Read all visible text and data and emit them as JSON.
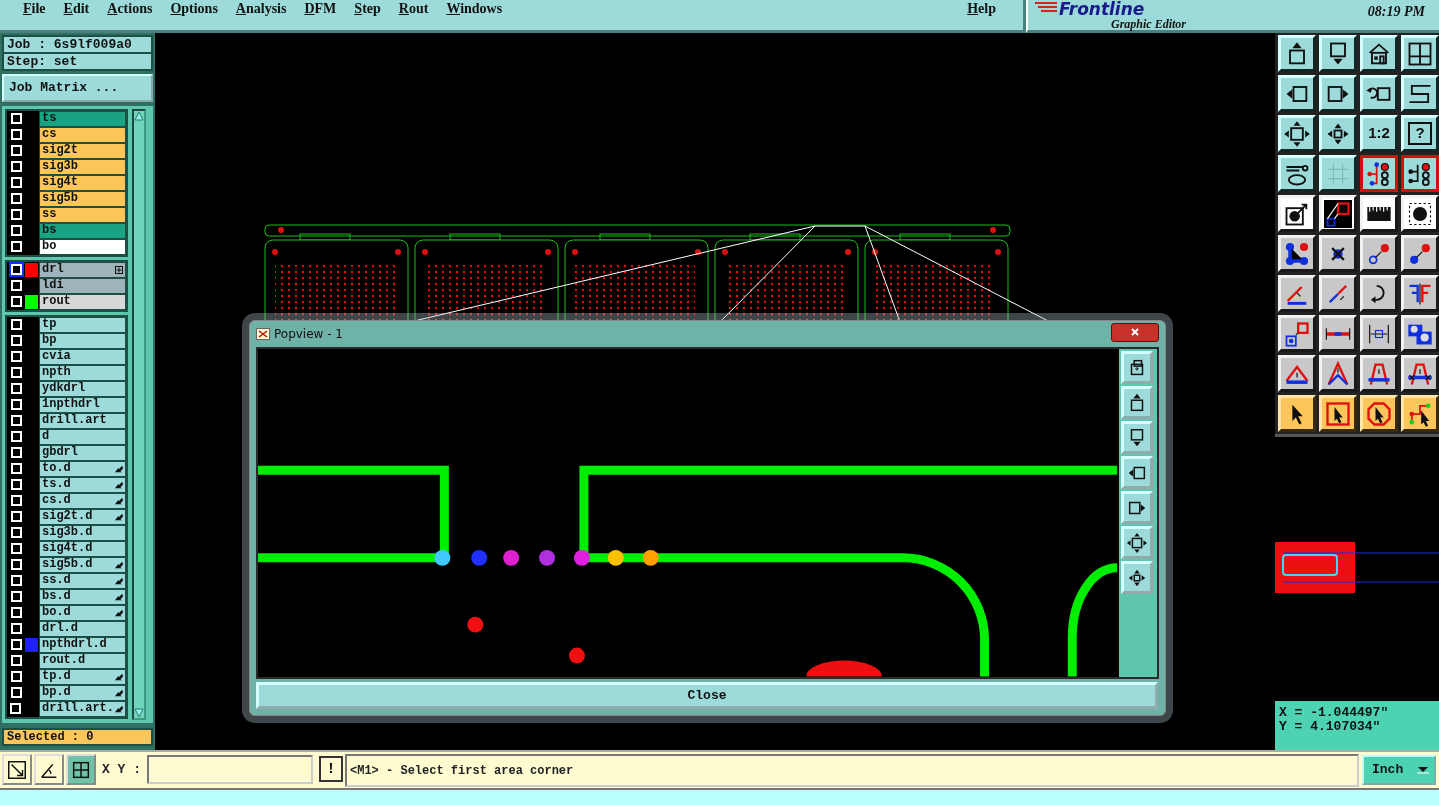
{
  "menu": [
    {
      "label": "File"
    },
    {
      "label": "Edit"
    },
    {
      "label": "Actions"
    },
    {
      "label": "Options"
    },
    {
      "label": "Analysis"
    },
    {
      "label": "DFM"
    },
    {
      "label": "Step"
    },
    {
      "label": "Rout"
    },
    {
      "label": "Windows"
    }
  ],
  "help": "Help",
  "brand": {
    "logo": "Frontline",
    "subtitle": "Graphic Editor",
    "time": "08:19 PM"
  },
  "job": "Job : 6s9lf009a0",
  "step": "Step: set",
  "matrix_button": "Job Matrix ...",
  "layer_groups": [
    [
      {
        "name": "ts",
        "kind": "mask",
        "checked": false,
        "active": false,
        "linked": false
      },
      {
        "name": "cs",
        "kind": "signal",
        "checked": false,
        "active": false,
        "linked": false
      },
      {
        "name": "sig2t",
        "kind": "signal",
        "checked": false,
        "active": false,
        "linked": false
      },
      {
        "name": "sig3b",
        "kind": "signal",
        "checked": false,
        "active": false,
        "linked": false
      },
      {
        "name": "sig4t",
        "kind": "signal",
        "checked": false,
        "active": false,
        "linked": false
      },
      {
        "name": "sig5b",
        "kind": "signal",
        "checked": false,
        "active": false,
        "linked": false
      },
      {
        "name": "ss",
        "kind": "signal",
        "checked": false,
        "active": false,
        "linked": false
      },
      {
        "name": "bs",
        "kind": "mask",
        "checked": false,
        "active": false,
        "linked": false
      },
      {
        "name": "bo",
        "kind": "outline",
        "checked": false,
        "active": false,
        "linked": false
      }
    ],
    [
      {
        "name": "drl",
        "kind": "drill",
        "color": "#ff0000",
        "checked": false,
        "active": true,
        "linked": false
      },
      {
        "name": "ldi",
        "kind": "drill",
        "checked": false,
        "active": false,
        "linked": false
      },
      {
        "name": "rout",
        "kind": "rout",
        "color": "#00ff00",
        "checked": false,
        "active": false,
        "linked": false
      }
    ],
    [
      {
        "name": "tp",
        "kind": "misc",
        "checked": false,
        "active": false,
        "linked": false
      },
      {
        "name": "bp",
        "kind": "misc",
        "checked": false,
        "active": false,
        "linked": false
      },
      {
        "name": "cvia",
        "kind": "misc",
        "checked": false,
        "active": false,
        "linked": false
      },
      {
        "name": "npth",
        "kind": "misc",
        "checked": false,
        "active": false,
        "linked": false
      },
      {
        "name": "ydkdrl",
        "kind": "misc",
        "checked": false,
        "active": false,
        "linked": false
      },
      {
        "name": "1npthdrl",
        "kind": "misc",
        "checked": false,
        "active": false,
        "linked": false
      },
      {
        "name": "drill.art",
        "kind": "misc",
        "checked": false,
        "active": false,
        "linked": false
      },
      {
        "name": "d",
        "kind": "misc",
        "checked": false,
        "active": false,
        "linked": false
      },
      {
        "name": "gbdrl",
        "kind": "misc",
        "checked": false,
        "active": false,
        "linked": false
      },
      {
        "name": "to.d",
        "kind": "misc",
        "checked": false,
        "active": false,
        "linked": true
      },
      {
        "name": "ts.d",
        "kind": "misc",
        "checked": false,
        "active": false,
        "linked": true
      },
      {
        "name": "cs.d",
        "kind": "misc",
        "checked": false,
        "active": false,
        "linked": true
      },
      {
        "name": "sig2t.d",
        "kind": "misc",
        "checked": false,
        "active": false,
        "linked": true
      },
      {
        "name": "sig3b.d",
        "kind": "misc",
        "checked": false,
        "active": false,
        "linked": false
      },
      {
        "name": "sig4t.d",
        "kind": "misc",
        "checked": false,
        "active": false,
        "linked": false
      },
      {
        "name": "sig5b.d",
        "kind": "misc",
        "checked": false,
        "active": false,
        "linked": true
      },
      {
        "name": "ss.d",
        "kind": "misc",
        "checked": false,
        "active": false,
        "linked": true
      },
      {
        "name": "bs.d",
        "kind": "misc",
        "checked": false,
        "active": false,
        "linked": true
      },
      {
        "name": "bo.d",
        "kind": "misc",
        "checked": false,
        "active": false,
        "linked": true
      },
      {
        "name": "drl.d",
        "kind": "misc",
        "checked": false,
        "active": false,
        "linked": false
      },
      {
        "name": "npthdrl.d",
        "kind": "misc",
        "color": "#2020ff",
        "checked": false,
        "active": false,
        "linked": false
      },
      {
        "name": "rout.d",
        "kind": "misc",
        "checked": false,
        "active": false,
        "linked": false
      },
      {
        "name": "tp.d",
        "kind": "misc",
        "checked": false,
        "active": false,
        "linked": true
      },
      {
        "name": "bp.d",
        "kind": "misc",
        "checked": false,
        "active": false,
        "linked": true
      },
      {
        "name": "drill.art.",
        "kind": "misc",
        "checked": false,
        "active": false,
        "linked": true
      }
    ]
  ],
  "selected_count": "Selected : 0",
  "toolbar": {
    "ratio": "1:2",
    "help": "?"
  },
  "popview": {
    "title": "Popview - 1",
    "close": "Close"
  },
  "coordinates": {
    "x": "X = -1.044497\"",
    "y": "Y = 4.107034\""
  },
  "command_bar": {
    "xy_label": "X Y :",
    "alert": "!",
    "prompt": "<M1> - Select first area corner",
    "units": "Inch"
  }
}
